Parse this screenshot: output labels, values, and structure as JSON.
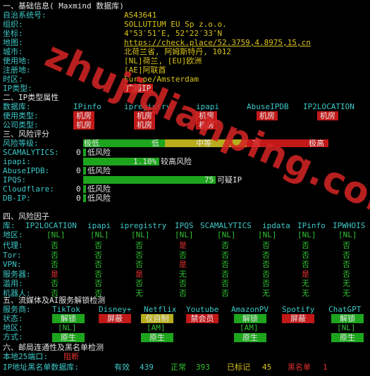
{
  "section1": {
    "title": "一、基础信息( Maxmind 数据库)",
    "fields": [
      {
        "label": "自治系统号:",
        "value": "AS43641"
      },
      {
        "label": "组织:",
        "value": "SOLLUTIUM EU Sp z.o.o."
      },
      {
        "label": "坐标:",
        "value": "4°53′51″E, 52°22′33″N"
      },
      {
        "label": "地图:",
        "value": "https://check.place/52.3759,4.8975,15,cn"
      },
      {
        "label": "城市:",
        "value": "北荷兰省, 阿姆斯特丹, 1012"
      },
      {
        "label": "使用地:",
        "value": "[NL]荷兰, [EU]欧洲"
      },
      {
        "label": "注册地:",
        "value": "[AE]阿联酋"
      },
      {
        "label": "时区:",
        "value": "Europe/Amsterdam"
      }
    ],
    "ip_type_label": "IP类型:",
    "ip_type_value": "广播IP"
  },
  "section2": {
    "title": "二、IP类型属性",
    "db_label": "数据库:",
    "columns": [
      "IPinfo",
      "ipregistry",
      "ipapi",
      "AbuseIPDB",
      "IP2LOCATION"
    ],
    "usage_label": "使用类型:",
    "usage": [
      "机房",
      "机房",
      "机房",
      "机房",
      "机房"
    ],
    "company_label": "公司类型:",
    "company": [
      "机房",
      "机房",
      "机房"
    ]
  },
  "section3": {
    "title": "三、风险评分",
    "level_label": "风险等级:",
    "scale": [
      "极低",
      "低",
      "中等",
      "高",
      "极高"
    ],
    "scores": [
      {
        "label": "SCAMALYTICS:",
        "score": "0",
        "text": "低风险",
        "fraction": 0.0
      },
      {
        "label": "ipapi:",
        "score": "1.10%",
        "text": "较高风险",
        "fraction": 0.31
      },
      {
        "label": "AbuseIPDB:",
        "score": "0",
        "text": "低风险",
        "fraction": 0.0
      },
      {
        "label": "IPQS:",
        "score": "75",
        "text": "可疑IP",
        "fraction": 0.54
      },
      {
        "label": "Cloudflare:",
        "score": "0",
        "text": "低风险",
        "fraction": 0.0
      },
      {
        "label": "DB-IP:",
        "score": "0",
        "text": "低风险",
        "fraction": 0.0
      }
    ]
  },
  "section4": {
    "title": "四、风险因子",
    "db_label": "库:",
    "columns": [
      "IP2LOCATION",
      "ipapi",
      "ipregistry",
      "IPQS",
      "SCAMALYTICS",
      "ipdata",
      "IPinfo",
      "IPWHOIS"
    ],
    "region_label": "地区:",
    "regions": [
      "[NL]",
      "[NL]",
      "[NL]",
      "[NL]",
      "[NL]",
      "[NL]",
      "[NL]",
      "[NL]"
    ],
    "rows": [
      {
        "label": "代理:",
        "values": [
          "否",
          "否",
          "否",
          "是",
          "否",
          "否",
          "否",
          "否"
        ]
      },
      {
        "label": "Tor:",
        "values": [
          "否",
          "否",
          "否",
          "否",
          "否",
          "否",
          "否",
          "否"
        ]
      },
      {
        "label": "VPN:",
        "values": [
          "否",
          "否",
          "否",
          "是",
          "否",
          "否",
          "否",
          "否"
        ]
      },
      {
        "label": "服务器:",
        "values": [
          "是",
          "否",
          "是",
          "无",
          "否",
          "否",
          "是",
          "否"
        ]
      },
      {
        "label": "滥用:",
        "values": [
          "否",
          "否",
          "否",
          "否",
          "否",
          "否",
          "无",
          "无"
        ]
      },
      {
        "label": "机器人:",
        "values": [
          "否",
          "否",
          "无",
          "否",
          "否",
          "无",
          "无",
          "无"
        ]
      }
    ]
  },
  "section5": {
    "title": "五、流媒体及AI服务解锁检测",
    "service_label": "服务商:",
    "services": [
      "TikTok",
      "Disney+",
      "Netflix",
      "Youtube",
      "AmazonPV",
      "Spotify",
      "ChatGPT"
    ],
    "status_label": "状态:",
    "status": [
      "解锁",
      "屏蔽",
      "仅自制",
      "禁会员",
      "解锁",
      "屏蔽",
      "解锁"
    ],
    "region_label": "地区:",
    "regions": [
      "[NL]",
      "",
      "[AM]",
      "",
      "[AM]",
      "",
      "[NL]"
    ],
    "method_label": "方式:",
    "methods": [
      "原生",
      "",
      "原生",
      "",
      "原生",
      "",
      "原生"
    ]
  },
  "section6": {
    "title": "六、邮局连通性及黑名单检测",
    "port25_label": "本地25端口:",
    "port25_value": "阻断",
    "blacklist_label": "IP地址黑名单数据库:",
    "valid_label": "有效",
    "valid_value": "439",
    "normal_label": "正常",
    "normal_value": "393",
    "marked_label": "已标记",
    "marked_value": "45",
    "blacklist_word": "黑名单",
    "blacklist_value": "1"
  },
  "watermark": "zhujidianping.com",
  "colors": {
    "green": "#1ea51e",
    "red": "#c21818",
    "yellow": "#b8ad1c",
    "cyan": "#3ec7c7"
  }
}
